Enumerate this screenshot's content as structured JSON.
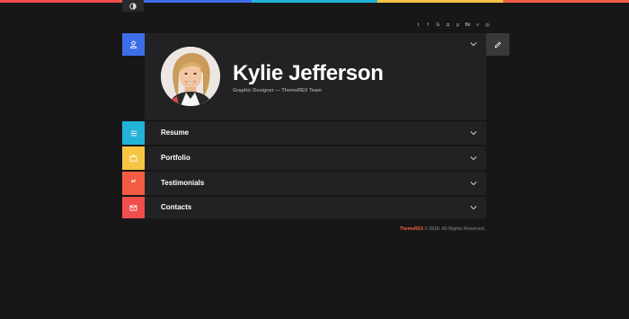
{
  "top_strip_colors": [
    "#f24d4d",
    "#3d6ee8",
    "#22b2d8",
    "#f7c544",
    "#f25c44"
  ],
  "theme_toggle": {
    "icon": "contrast-icon"
  },
  "social_icons": [
    "twitter-icon",
    "facebook-icon",
    "google-icon",
    "instagram-icon",
    "pinterest-icon",
    "behance-icon",
    "vimeo-icon",
    "dribbble-icon"
  ],
  "profile": {
    "name": "Kylie Jefferson",
    "subtitle": "Graphic Designer — ThemeREX Team",
    "icon": "user-icon",
    "icon_color": "#3d6ee8"
  },
  "sections": [
    {
      "label": "Resume",
      "icon": "menu-lines-icon",
      "color": "#22b2d8"
    },
    {
      "label": "Portfolio",
      "icon": "briefcase-icon",
      "color": "#f7c544"
    },
    {
      "label": "Testimonials",
      "icon": "quote-icon",
      "color": "#f25c44"
    },
    {
      "label": "Contacts",
      "icon": "envelope-icon",
      "color": "#f24d4d"
    }
  ],
  "edit_button": {
    "icon": "pencil-icon"
  },
  "footer": {
    "brand": "ThemeREX",
    "text": " © 2018. All Rights Reserved."
  }
}
